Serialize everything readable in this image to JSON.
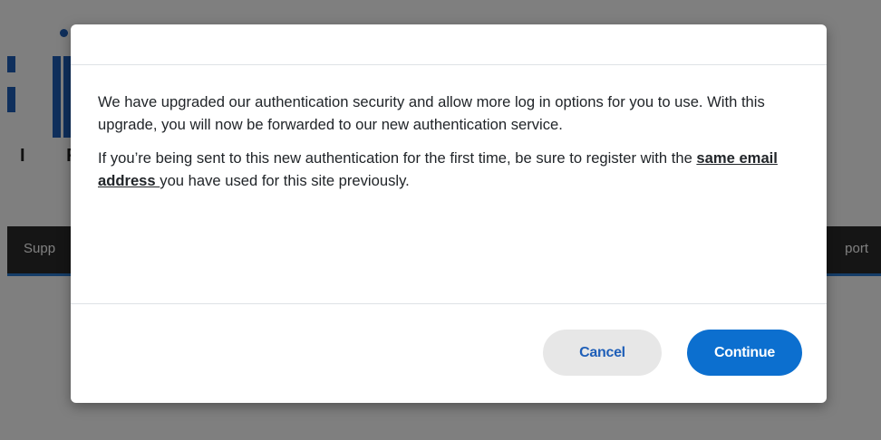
{
  "background_page": {
    "logo": {
      "tagline": "I R"
    },
    "nav": {
      "left_item": "Supp",
      "right_item": "port"
    }
  },
  "modal": {
    "body": {
      "paragraph1": "We have upgraded our authentication security and allow more log in options for you to use. With this upgrade, you will now be forwarded to our new authentication service.",
      "paragraph2_before": "If you’re being sent to this new authentication for the first time, be sure to register with the ",
      "paragraph2_link": "same email address ",
      "paragraph2_after": "you have used for this site previously."
    },
    "footer": {
      "cancel_label": "Cancel",
      "continue_label": "Continue"
    }
  },
  "colors": {
    "overlay": "rgba(0,0,0,0.5)",
    "primary_button": "#0c6fcf",
    "secondary_button": "#e7e7e7",
    "secondary_button_text": "#1f5fb8",
    "nav_background": "#2b2b2b",
    "brand_blue": "#1f5fb8"
  },
  "icons": {
    "logo": "brand-logo-bars"
  }
}
